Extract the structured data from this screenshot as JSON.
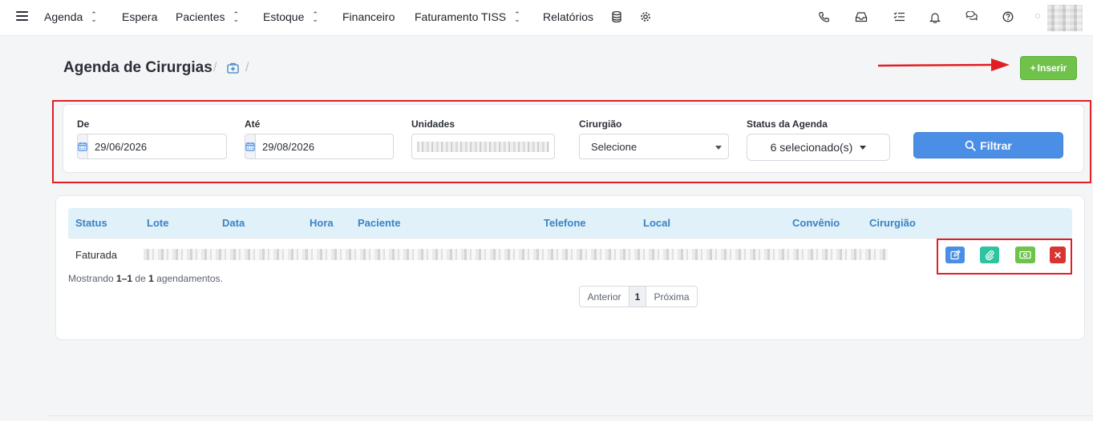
{
  "nav": {
    "items": [
      {
        "label": "Agenda",
        "has_dropdown": true
      },
      {
        "label": "Espera",
        "has_dropdown": false
      },
      {
        "label": "Pacientes",
        "has_dropdown": true
      },
      {
        "label": "Estoque",
        "has_dropdown": true
      },
      {
        "label": "Financeiro",
        "has_dropdown": false
      },
      {
        "label": "Faturamento TISS",
        "has_dropdown": true
      },
      {
        "label": "Relatórios",
        "has_dropdown": false
      }
    ],
    "icons": [
      "database-icon",
      "gear-icon",
      "phone-icon",
      "inbox-icon",
      "checklist-icon",
      "bell-icon",
      "chat-icon",
      "help-icon"
    ]
  },
  "header": {
    "title": "Agenda de Cirurgias",
    "insert_label": "Inserir"
  },
  "filters": {
    "de_label": "De",
    "de_value": "29/06/2026",
    "ate_label": "Até",
    "ate_value": "29/08/2026",
    "unidades_label": "Unidades",
    "cirurgiao_label": "Cirurgião",
    "cirurgiao_value": "Selecione",
    "status_label": "Status da Agenda",
    "status_value": "6 selecionado(s)",
    "filter_button": "Filtrar"
  },
  "table": {
    "columns": [
      "Status",
      "Lote",
      "Data",
      "Hora",
      "Paciente",
      "Telefone",
      "Local",
      "Convênio",
      "Cirurgião"
    ],
    "rows": [
      {
        "status": "Faturada"
      }
    ]
  },
  "summary": {
    "prefix": "Mostrando",
    "range": "1–1",
    "of": "de",
    "total": "1",
    "suffix": "agendamentos."
  },
  "pagination": {
    "prev": "Anterior",
    "current": "1",
    "next": "Próxima"
  },
  "colors": {
    "accent_blue": "#4a8fe5",
    "success_green": "#6fc24a",
    "teal": "#2ec4a0",
    "danger_red": "#d93434",
    "highlight_red": "#e01f25",
    "header_blue_text": "#3b82c4"
  }
}
